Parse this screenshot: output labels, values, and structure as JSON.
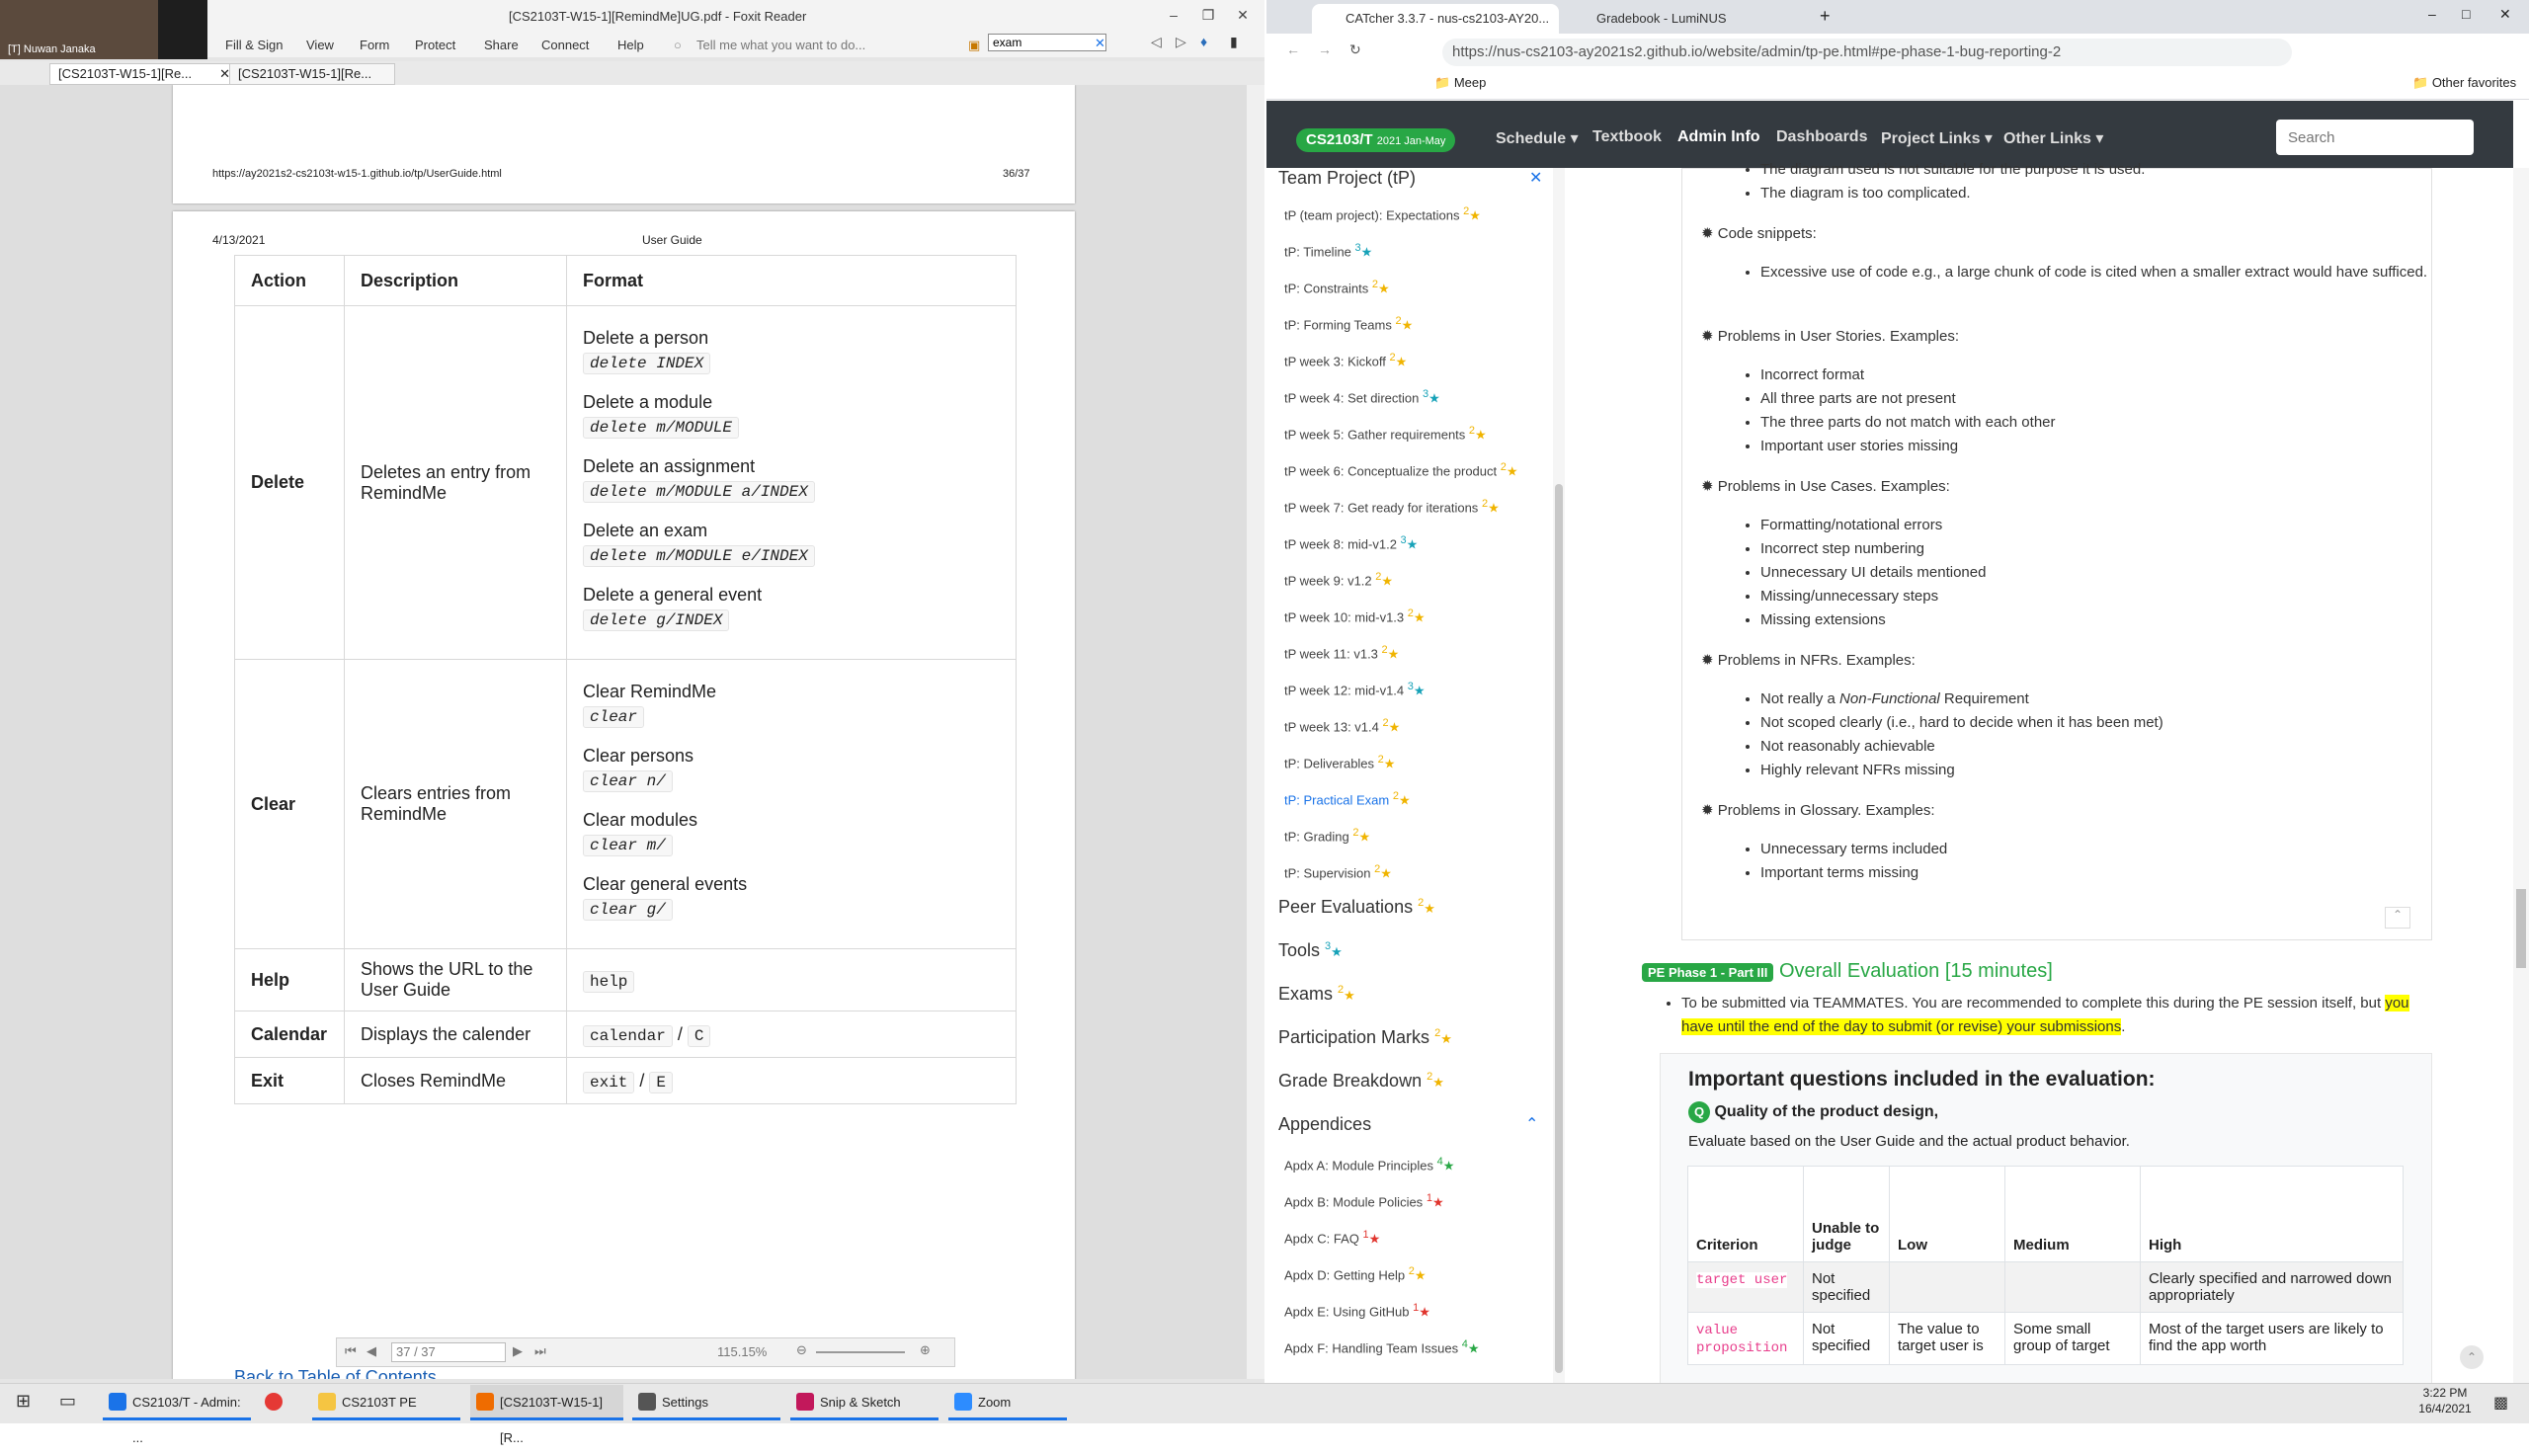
{
  "foxit": {
    "window_title": "[CS2103T-W15-1][RemindMe]UG.pdf - Foxit Reader",
    "webcam_name": "[T] Nuwan Janaka",
    "menu": [
      "Fill & Sign",
      "View",
      "Form",
      "Protect",
      "Share",
      "Connect",
      "Help"
    ],
    "tell_me_placeholder": "Tell me what you want to do...",
    "search_value": "exam",
    "tabs": [
      "[CS2103T-W15-1][Re...",
      "[CS2103T-W15-1][Re..."
    ],
    "page_top": {
      "url": "https://ay2021s2-cs2103t-w15-1.github.io/tp/UserGuide.html",
      "page_number": "36/37"
    },
    "page_header": {
      "date": "4/13/2021",
      "title": "User Guide"
    },
    "table": {
      "headers": [
        "Action",
        "Description",
        "Format"
      ],
      "rows": [
        {
          "action": "Delete",
          "description": "Deletes an entry from RemindMe",
          "formats": [
            {
              "label": "Delete a person",
              "code": "delete INDEX"
            },
            {
              "label": "Delete a module",
              "code": "delete m/MODULE"
            },
            {
              "label": "Delete an assignment",
              "code": "delete m/MODULE a/INDEX"
            },
            {
              "label": "Delete an exam",
              "code": "delete m/MODULE e/INDEX"
            },
            {
              "label": "Delete a general event",
              "code": "delete g/INDEX"
            }
          ]
        },
        {
          "action": "Clear",
          "description": "Clears entries from RemindMe",
          "formats": [
            {
              "label": "Clear RemindMe",
              "code": "clear"
            },
            {
              "label": "Clear persons",
              "code": "clear n/"
            },
            {
              "label": "Clear modules",
              "code": "clear m/"
            },
            {
              "label": "Clear general events",
              "code": "clear g/"
            }
          ]
        },
        {
          "action": "Help",
          "description": "Shows the URL to the User Guide",
          "code": "help"
        },
        {
          "action": "Calendar",
          "description": "Displays the calender",
          "code1": "calendar",
          "sep": " / ",
          "code2": "C"
        },
        {
          "action": "Exit",
          "description": "Closes RemindMe",
          "code1": "exit",
          "sep": " / ",
          "code2": "E"
        }
      ]
    },
    "back_link": "Back to Table of Contents",
    "status": {
      "page_field": "37 / 37",
      "zoom": "115.15%"
    }
  },
  "chrome": {
    "tabs": [
      "CATcher 3.3.7 - nus-cs2103-AY20...",
      "Gradebook - LumiNUS"
    ],
    "url": "https://nus-cs2103-ay2021s2.github.io/website/admin/tp-pe.html#pe-phase-1-bug-reporting-2",
    "bookmarks": {
      "folder": "Meep",
      "other": "Other favorites"
    }
  },
  "site": {
    "brand": "CS2103/T",
    "brand_sub": "2021 Jan-May",
    "nav": [
      "Schedule ▾",
      "Textbook",
      "Admin Info",
      "Dashboards",
      "Project Links ▾",
      "Other Links ▾"
    ],
    "search_placeholder": "Search",
    "sidebar": {
      "section_team": "Team Project (tP)",
      "items": [
        {
          "label": "tP (team project): Expectations",
          "n": "2",
          "color": "yellow"
        },
        {
          "label": "tP: Timeline",
          "n": "3",
          "color": "teal"
        },
        {
          "label": "tP: Constraints",
          "n": "2",
          "color": "yellow"
        },
        {
          "label": "tP: Forming Teams",
          "n": "2",
          "color": "yellow"
        },
        {
          "label": "tP week 3: Kickoff",
          "n": "2",
          "color": "yellow"
        },
        {
          "label": "tP week 4: Set direction",
          "n": "3",
          "color": "teal"
        },
        {
          "label": "tP week 5: Gather requirements",
          "n": "2",
          "color": "yellow"
        },
        {
          "label": "tP week 6: Conceptualize the product",
          "n": "2",
          "color": "yellow"
        },
        {
          "label": "tP week 7: Get ready for iterations",
          "n": "2",
          "color": "yellow"
        },
        {
          "label": "tP week 8: mid-v1.2",
          "n": "3",
          "color": "teal"
        },
        {
          "label": "tP week 9: v1.2",
          "n": "2",
          "color": "yellow"
        },
        {
          "label": "tP week 10: mid-v1.3",
          "n": "2",
          "color": "yellow"
        },
        {
          "label": "tP week 11: v1.3",
          "n": "2",
          "color": "yellow"
        },
        {
          "label": "tP week 12: mid-v1.4",
          "n": "3",
          "color": "teal"
        },
        {
          "label": "tP week 13: v1.4",
          "n": "2",
          "color": "yellow"
        },
        {
          "label": "tP: Deliverables",
          "n": "2",
          "color": "yellow"
        },
        {
          "label": "tP: Practical Exam",
          "n": "2",
          "color": "yellow",
          "current": true
        },
        {
          "label": "tP: Grading",
          "n": "2",
          "color": "yellow"
        },
        {
          "label": "tP: Supervision",
          "n": "2",
          "color": "yellow"
        }
      ],
      "sections": [
        {
          "label": "Peer Evaluations",
          "n": "2",
          "color": "yellow"
        },
        {
          "label": "Tools",
          "n": "3",
          "color": "teal"
        },
        {
          "label": "Exams",
          "n": "2",
          "color": "yellow"
        },
        {
          "label": "Participation Marks",
          "n": "2",
          "color": "yellow"
        },
        {
          "label": "Grade Breakdown",
          "n": "2",
          "color": "yellow"
        },
        {
          "label": "Appendices",
          "n": "",
          "color": ""
        }
      ],
      "appendices": [
        {
          "label": "Apdx A: Module Principles",
          "n": "4",
          "color": "green"
        },
        {
          "label": "Apdx B: Module Policies",
          "n": "1",
          "color": "red"
        },
        {
          "label": "Apdx C: FAQ",
          "n": "1",
          "color": "red"
        },
        {
          "label": "Apdx D: Getting Help",
          "n": "2",
          "color": "yellow"
        },
        {
          "label": "Apdx E: Using GitHub",
          "n": "1",
          "color": "red"
        },
        {
          "label": "Apdx F: Handling Team Issues",
          "n": "4",
          "color": "green"
        }
      ]
    },
    "content": {
      "top_bullets": [
        "The diagram used is not suitable for the purpose it is used.",
        "The diagram is too complicated."
      ],
      "groups": [
        {
          "title": "Code snippets:",
          "items": [
            "Excessive use of code e.g., a large chunk of code is cited when a smaller extract would have sufficed."
          ]
        },
        {
          "title": "Problems in User Stories. Examples:",
          "items": [
            "Incorrect format",
            "All three parts are not present",
            "The three parts do not match with each other",
            "Important user stories missing"
          ]
        },
        {
          "title": "Problems in Use Cases. Examples:",
          "items": [
            "Formatting/notational errors",
            "Incorrect step numbering",
            "Unnecessary UI details mentioned",
            "Missing/unnecessary steps",
            "Missing extensions"
          ]
        },
        {
          "title": "Problems in NFRs. Examples:",
          "items_html": [
            "Not really a <i>Non-Functional</i> Requirement",
            "Not scoped clearly (i.e., hard to decide when it has been met)",
            "Not reasonably achievable",
            "Highly relevant NFRs missing"
          ]
        },
        {
          "title": "Problems in Glossary. Examples:",
          "items": [
            "Unnecessary terms included",
            "Important terms missing"
          ]
        }
      ],
      "part3_badge": "PE Phase 1 - Part III",
      "part3_title": "Overall Evaluation [15 minutes]",
      "part3_text": "To be submitted via TEAMMATES. You are recommended to complete this during the PE session itself, but",
      "part3_highlight": "you have until the end of the day to submit (or revise) your submissions",
      "eval_heading": "Important questions included in the evaluation:",
      "q_badge": "Q",
      "q_title": "Quality of the product design,",
      "q_text": "Evaluate based on the User Guide and the actual product behavior.",
      "crit_headers": [
        "Criterion",
        "Unable to judge",
        "Low",
        "Medium",
        "High"
      ],
      "crit_rows": [
        {
          "criterion": "target user",
          "unable": "Not specified",
          "low": "",
          "medium": "",
          "high": "Clearly specified and narrowed down appropriately"
        },
        {
          "criterion": "value proposition",
          "unable": "Not specified",
          "low": "The value to target user is",
          "medium": "Some small group of target",
          "high": "Most of the target users are likely to find the app worth"
        }
      ]
    }
  },
  "taskbar": {
    "apps": [
      "CS2103/T - Admin: ...",
      "",
      "CS2103T PE",
      "[CS2103T-W15-1][R...",
      "Settings",
      "Snip & Sketch",
      "Zoom"
    ],
    "time": "3:22 PM",
    "date": "16/4/2021"
  }
}
